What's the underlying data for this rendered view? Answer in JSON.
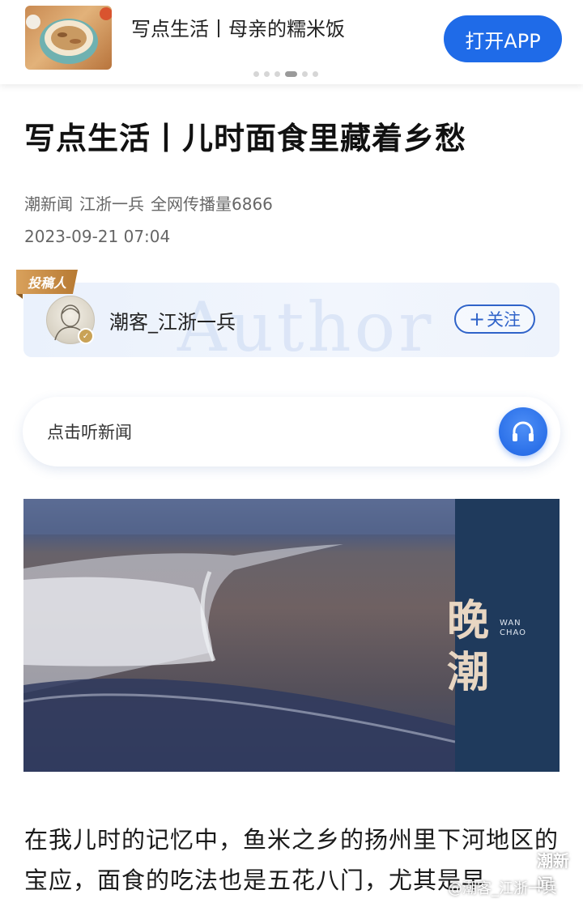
{
  "banner": {
    "title": "写点生活丨母亲的糯米饭",
    "open_app_label": "打开APP",
    "carousel_dots": 6,
    "carousel_active_index": 3
  },
  "article": {
    "title": "写点生活丨儿时面食里藏着乡愁",
    "source": "潮新闻",
    "author": "江浙一兵",
    "reach": "全网传播量6866",
    "date": "2023-09-21 07:04"
  },
  "author_card": {
    "tag": "投稿人",
    "watermark": "Author",
    "name": "潮客_江浙一兵",
    "follow_label": "关注",
    "follow_icon": "plus-icon"
  },
  "listen": {
    "label": "点击听新闻",
    "icon": "headphones-icon"
  },
  "hero": {
    "char1": "晚",
    "char2": "潮",
    "latin1": "WAN",
    "latin2": "CHAO"
  },
  "body": {
    "paragraph": "在我儿时的记忆中，鱼米之乡的扬州里下河地区的宝应，面食的吃法也是五花八门，尤其是早"
  },
  "watermark": {
    "brand": "潮新闻",
    "handle": "@潮客_江浙一兵"
  },
  "colors": {
    "accent": "#1f6be8",
    "follow": "#2f63c9",
    "tag": "#c98b44"
  }
}
